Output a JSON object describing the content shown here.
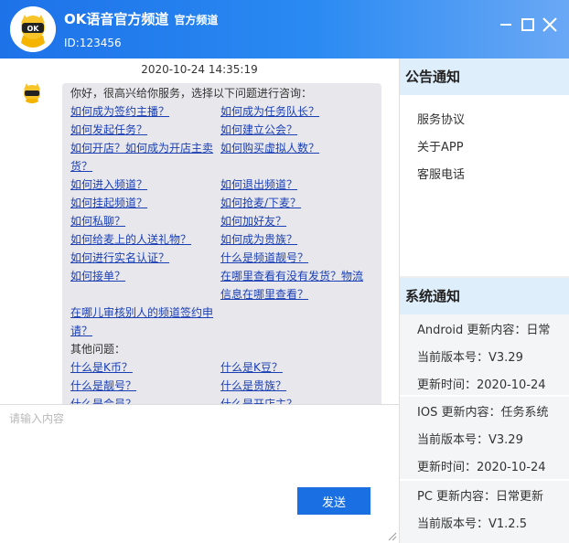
{
  "header": {
    "app_name": "OK语音官方频道",
    "official_badge": "官方频道",
    "user_id": "ID:123456",
    "avatar_letters": "OK"
  },
  "chat": {
    "timestamp": "2020-10-24 14:35:19",
    "intro": "你好，很高兴给你服务，选择以下问题进行咨询：",
    "links": {
      "r1a": "如何成为签约主播？",
      "r1b": "如何成为任务队长？",
      "r2a": "如何发起任务？",
      "r2b": "如何建立公会？",
      "r3a": "如何开店？如何成为开店主卖",
      "r3a2": "货？",
      "r3b": "如何购买虚拟人数？",
      "r4a": "如何进入频道？",
      "r4b": "如何退出频道？",
      "r5a": "如何挂起频道？",
      "r5b": "如何抢麦/下麦？",
      "r6a": "如何私聊？",
      "r6b": "如何加好友？",
      "r7a": "如何给麦上的人送礼物？",
      "r7b": "如何成为贵族？",
      "r8a": "如何进行实名认证？",
      "r8b": "什么是频道靓号？",
      "r9a": "如何接单？",
      "r9b": "在哪里查看有没有发货？物流",
      "r9b2": "信息在哪里查看？",
      "r10a": "在哪儿审核别人的频道签约申",
      "r10a2": "请？"
    },
    "other_label": "其他问题：",
    "other_links": {
      "o1a": "什么是K币？",
      "o1b": "什么是K豆？",
      "o2a": "什么是靓号？",
      "o2b": "什么是贵族？",
      "o3a": "什么是会员？",
      "o3b": "什么是开店主？"
    }
  },
  "input": {
    "placeholder": "请输入内容",
    "send_label": "发送"
  },
  "announcements": {
    "title": "公告通知",
    "items": [
      "服务协议",
      "关于APP",
      "客服电话"
    ]
  },
  "system": {
    "title": "系统通知",
    "notices": [
      {
        "content": "Android 更新内容：日常",
        "version": "当前版本号：V3.29",
        "time": "更新时间：2020-10-24"
      },
      {
        "content": "IOS 更新内容：任务系统",
        "version": "当前版本号：V3.29",
        "time": "更新时间：2020-10-24"
      },
      {
        "content": "PC 更新内容：日常更新",
        "version": "当前版本号：V1.2.5"
      }
    ]
  },
  "colors": {
    "header_start": "#1d72e8",
    "accent": "#1a6fe3",
    "link": "#1a3fb5",
    "panel_head": "#dfeefb"
  }
}
